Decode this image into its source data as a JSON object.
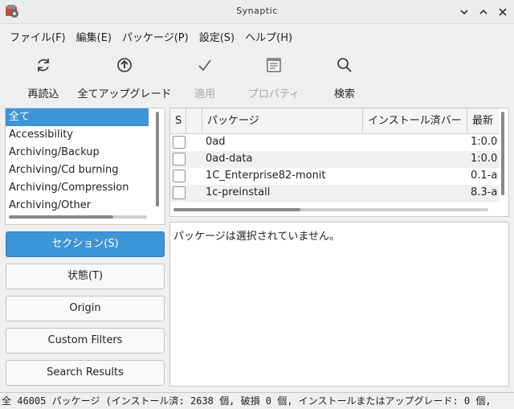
{
  "window": {
    "title": "Synaptic"
  },
  "menubar": {
    "items": [
      "ファイル(F)",
      "編集(E)",
      "パッケージ(P)",
      "設定(S)",
      "ヘルプ(H)"
    ]
  },
  "toolbar": {
    "reload": {
      "label": "再読込",
      "icon": "reload-icon"
    },
    "upgrade_all": {
      "label": "全てアップグレード",
      "icon": "upgrade-icon"
    },
    "apply": {
      "label": "適用",
      "icon": "checkmark-icon",
      "disabled": true
    },
    "properties": {
      "label": "プロパティ",
      "icon": "properties-icon",
      "disabled": true
    },
    "search": {
      "label": "検索",
      "icon": "search-icon"
    }
  },
  "sections": {
    "items": [
      "全て",
      "Accessibility",
      "Archiving/Backup",
      "Archiving/Cd burning",
      "Archiving/Compression",
      "Archiving/Other"
    ],
    "selected_index": 0
  },
  "filter_buttons": {
    "sections": "セクション(S)",
    "status": "状態(T)",
    "origin": "Origin",
    "custom_filters": "Custom Filters",
    "search_results": "Search Results"
  },
  "package_table": {
    "columns": {
      "status": "S",
      "package": "パッケージ",
      "installed_version": "インストール済バー",
      "latest_version": "最新"
    },
    "rows": [
      {
        "name": "0ad",
        "version": "1:0.0"
      },
      {
        "name": "0ad-data",
        "version": "1:0.0"
      },
      {
        "name": "1C_Enterprise82-monit",
        "version": "0.1-a"
      },
      {
        "name": "1c-preinstall",
        "version": "8.3-a"
      }
    ]
  },
  "description": {
    "text": "パッケージは選択されていません。"
  },
  "statusbar": {
    "text": "全 46005 パッケージ (インストール済: 2638 個, 破損 0 個, インストールまたはアップグレード: 0 個,"
  },
  "colors": {
    "accent": "#3d95d8",
    "background": "#efefef"
  }
}
